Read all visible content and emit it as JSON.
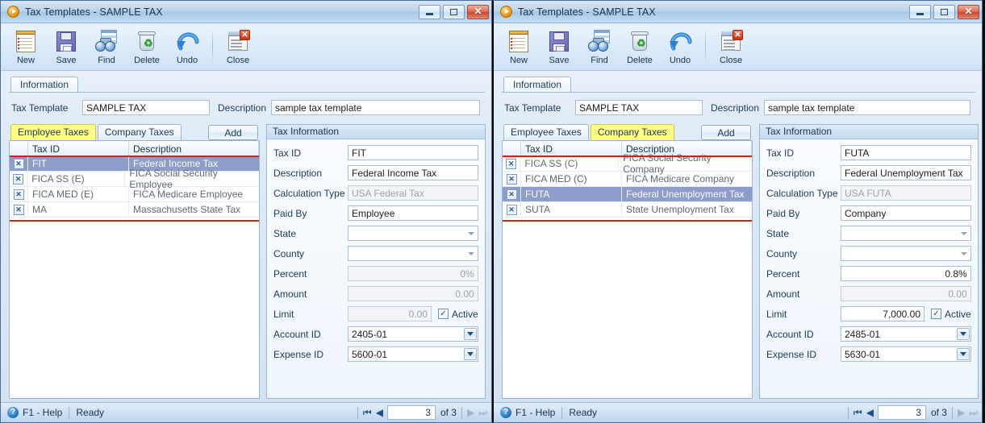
{
  "windows": [
    {
      "title": "Tax Templates - SAMPLE TAX",
      "toolbar": {
        "new": "New",
        "save": "Save",
        "find": "Find",
        "delete": "Delete",
        "undo": "Undo",
        "close": "Close"
      },
      "titlebar_buttons": {
        "minimize": "–",
        "maximize": "□",
        "close": "✕"
      },
      "tab_information": "Information",
      "form": {
        "tax_template_label": "Tax Template",
        "tax_template_value": "SAMPLE TAX",
        "description_label": "Description",
        "description_value": "sample tax template"
      },
      "grid": {
        "tabs": [
          {
            "label": "Employee Taxes",
            "highlighted": true
          },
          {
            "label": "Company Taxes",
            "highlighted": false
          }
        ],
        "add_label": "Add",
        "columns": [
          "",
          "Tax ID",
          "Description"
        ],
        "rows": [
          {
            "x": "✕",
            "tax_id": "FIT",
            "description": "Federal Income Tax",
            "selected": true
          },
          {
            "x": "✕",
            "tax_id": "FICA SS (E)",
            "description": "FICA Social Security Employee",
            "selected": false
          },
          {
            "x": "✕",
            "tax_id": "FICA MED (E)",
            "description": "FICA Medicare Employee",
            "selected": false
          },
          {
            "x": "✕",
            "tax_id": "MA",
            "description": "Massachusetts State Tax",
            "selected": false
          }
        ]
      },
      "info": {
        "header": "Tax Information",
        "tax_id_label": "Tax ID",
        "tax_id_value": "FIT",
        "description_label": "Description",
        "description_value": "Federal Income Tax",
        "calculation_type_label": "Calculation Type",
        "calculation_type_value": "USA Federal Tax",
        "paid_by_label": "Paid By",
        "paid_by_value": "Employee",
        "state_label": "State",
        "state_value": "",
        "county_label": "County",
        "county_value": "",
        "percent_label": "Percent",
        "percent_value": "0%",
        "amount_label": "Amount",
        "amount_value": "0.00",
        "limit_label": "Limit",
        "limit_value": "0.00",
        "active_label": "Active",
        "active_checked": "✓",
        "account_id_label": "Account ID",
        "account_id_value": "2405-01",
        "expense_id_label": "Expense ID",
        "expense_id_value": "5600-01"
      },
      "status": {
        "help": "F1 - Help",
        "state": "Ready",
        "help_icon_glyph": "?",
        "page_value": "3",
        "of_text": "of 3",
        "first_glyph": "⏮",
        "prev_glyph": "◀",
        "next_glyph": "▶",
        "last_glyph": "⏭"
      }
    },
    {
      "title": "Tax Templates - SAMPLE TAX",
      "toolbar": {
        "new": "New",
        "save": "Save",
        "find": "Find",
        "delete": "Delete",
        "undo": "Undo",
        "close": "Close"
      },
      "titlebar_buttons": {
        "minimize": "–",
        "maximize": "□",
        "close": "✕"
      },
      "tab_information": "Information",
      "form": {
        "tax_template_label": "Tax Template",
        "tax_template_value": "SAMPLE TAX",
        "description_label": "Description",
        "description_value": "sample tax template"
      },
      "grid": {
        "tabs": [
          {
            "label": "Employee Taxes",
            "highlighted": false
          },
          {
            "label": "Company Taxes",
            "highlighted": true
          }
        ],
        "add_label": "Add",
        "columns": [
          "",
          "Tax ID",
          "Description"
        ],
        "rows": [
          {
            "x": "✕",
            "tax_id": "FICA SS (C)",
            "description": "FICA Social Security Company",
            "selected": false
          },
          {
            "x": "✕",
            "tax_id": "FICA MED (C)",
            "description": "FICA Medicare Company",
            "selected": false
          },
          {
            "x": "✕",
            "tax_id": "FUTA",
            "description": "Federal Unemployment Tax",
            "selected": true
          },
          {
            "x": "✕",
            "tax_id": "SUTA",
            "description": "State Unemployment Tax",
            "selected": false
          }
        ]
      },
      "info": {
        "header": "Tax Information",
        "tax_id_label": "Tax ID",
        "tax_id_value": "FUTA",
        "description_label": "Description",
        "description_value": "Federal Unemployment Tax",
        "calculation_type_label": "Calculation Type",
        "calculation_type_value": "USA FUTA",
        "paid_by_label": "Paid By",
        "paid_by_value": "Company",
        "state_label": "State",
        "state_value": "",
        "county_label": "County",
        "county_value": "",
        "percent_label": "Percent",
        "percent_value": "0.8%",
        "amount_label": "Amount",
        "amount_value": "0.00",
        "limit_label": "Limit",
        "limit_value": "7,000.00",
        "active_label": "Active",
        "active_checked": "✓",
        "account_id_label": "Account ID",
        "account_id_value": "2485-01",
        "expense_id_label": "Expense ID",
        "expense_id_value": "5630-01"
      },
      "status": {
        "help": "F1 - Help",
        "state": "Ready",
        "help_icon_glyph": "?",
        "page_value": "3",
        "of_text": "of 3",
        "first_glyph": "⏮",
        "prev_glyph": "◀",
        "next_glyph": "▶",
        "last_glyph": "⏭"
      }
    }
  ],
  "colors": {
    "selection_blue": "#8d9cc8",
    "tab_highlight_yellow": "#ffff88",
    "annotation_red": "#e01b14",
    "title_text": "#15334f"
  }
}
